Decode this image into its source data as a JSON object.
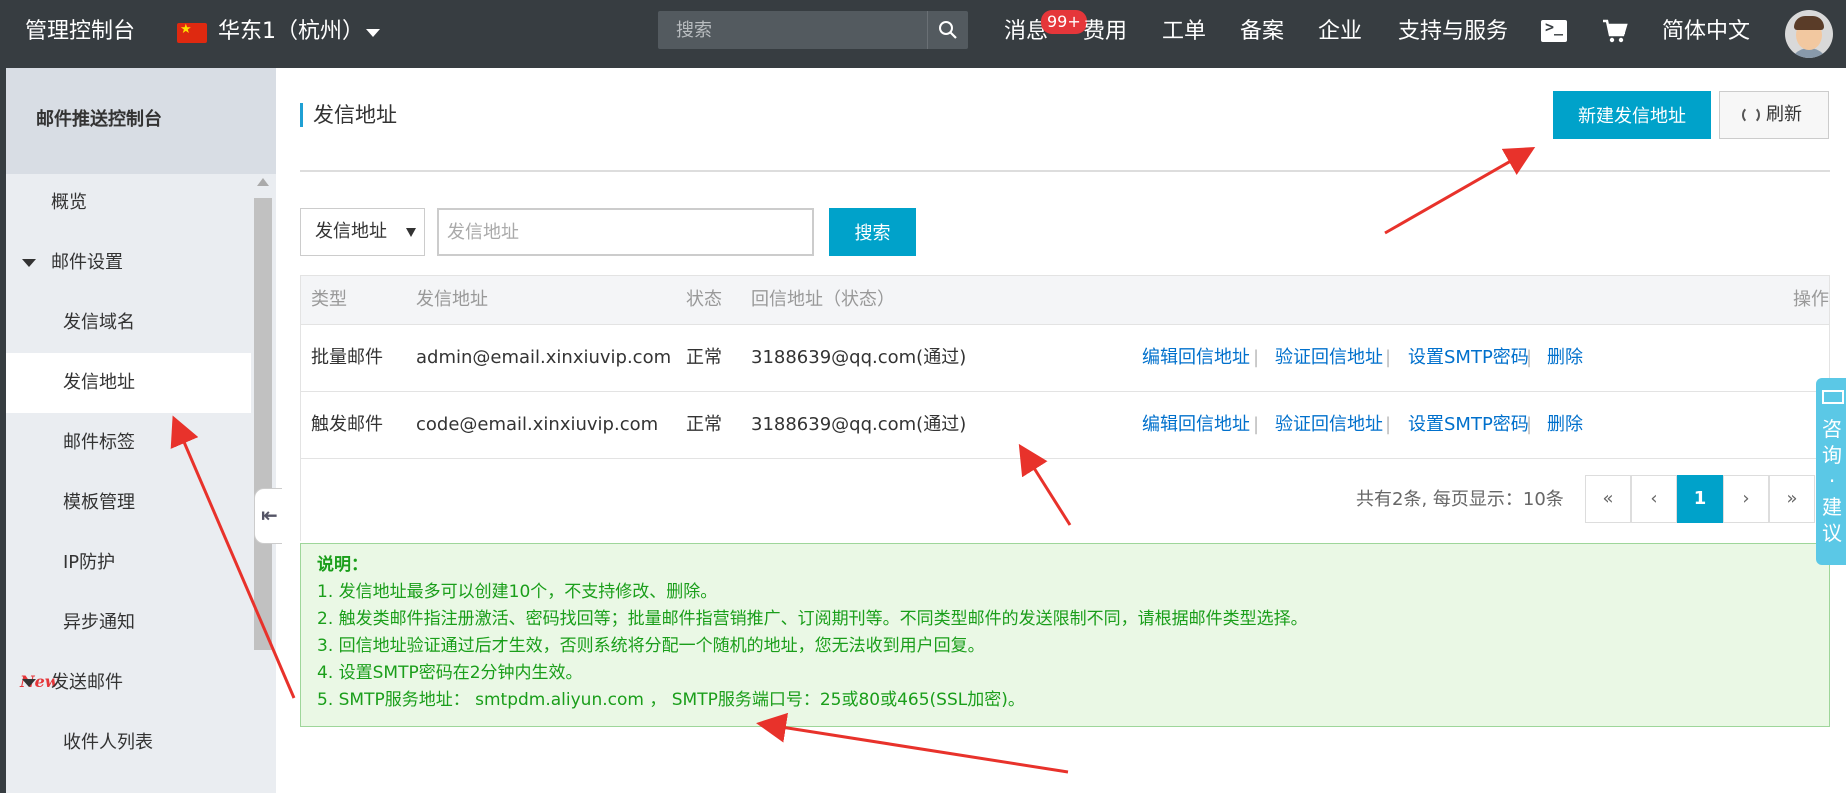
{
  "topbar": {
    "brand": "管理控制台",
    "region": "华东1（杭州）",
    "search_placeholder": "搜索",
    "nav": [
      "消息",
      "费用",
      "工单",
      "备案",
      "企业",
      "支持与服务"
    ],
    "message_badge": "99+",
    "language": "简体中文"
  },
  "sidebar": {
    "title": "邮件推送控制台",
    "items": [
      {
        "label": "概览"
      },
      {
        "label": "邮件设置"
      },
      {
        "label": "发信域名"
      },
      {
        "label": "发信地址"
      },
      {
        "label": "邮件标签"
      },
      {
        "label": "模板管理"
      },
      {
        "label": "IP防护"
      },
      {
        "label": "异步通知"
      },
      {
        "label": "发送邮件"
      },
      {
        "label": "收件人列表"
      }
    ],
    "new_badge": "New"
  },
  "main": {
    "title": "发信地址",
    "new_button": "新建发信地址",
    "refresh_button": "刷新",
    "filter": {
      "select_value": "发信地址",
      "input_placeholder": "发信地址",
      "search_button": "搜索"
    },
    "table": {
      "headers": [
        "类型",
        "发信地址",
        "状态",
        "回信地址（状态）",
        "操作"
      ],
      "rows": [
        {
          "type": "批量邮件",
          "address": "admin@email.xinxiuvip.com",
          "status": "正常",
          "reply": "3188639@qq.com(通过)"
        },
        {
          "type": "触发邮件",
          "address": "code@email.xinxiuvip.com",
          "status": "正常",
          "reply": "3188639@qq.com(通过)"
        }
      ],
      "actions": [
        "编辑回信地址",
        "验证回信地址",
        "设置SMTP密码",
        "删除"
      ],
      "separator": "|"
    },
    "pagination": {
      "info": "共有2条, 每页显示：10条",
      "first": "«",
      "prev": "‹",
      "current": "1",
      "next": "›",
      "last": "»"
    },
    "notes": {
      "title": "说明：",
      "lines": [
        "1. 发信地址最多可以创建10个，不支持修改、删除。",
        "2. 触发类邮件指注册激活、密码找回等；批量邮件指营销推广、订阅期刊等。不同类型邮件的发送限制不同，请根据邮件类型选择。",
        "3. 回信地址验证通过后才生效，否则系统将分配一个随机的地址，您无法收到用户回复。",
        "4. 设置SMTP密码在2分钟内生效。",
        "5. SMTP服务地址： smtpdm.aliyun.com ， SMTP服务端口号：25或80或465(SSL加密)。"
      ]
    }
  },
  "consult": {
    "text": "咨询·建议"
  },
  "icons": {
    "search": "search-icon",
    "terminal": "terminal-icon",
    "cart": "cart-icon",
    "refresh": "refresh-icon",
    "mail": "mail-icon",
    "collapse": "collapse-icon"
  },
  "colors": {
    "topbar": "#373d41",
    "primary": "#00a2ca",
    "link": "#0070cc",
    "notes_text": "#1a9e1a",
    "notes_bg": "#eaf8e5",
    "annotation_arrow": "#e8322b",
    "badge": "#e5363a"
  }
}
